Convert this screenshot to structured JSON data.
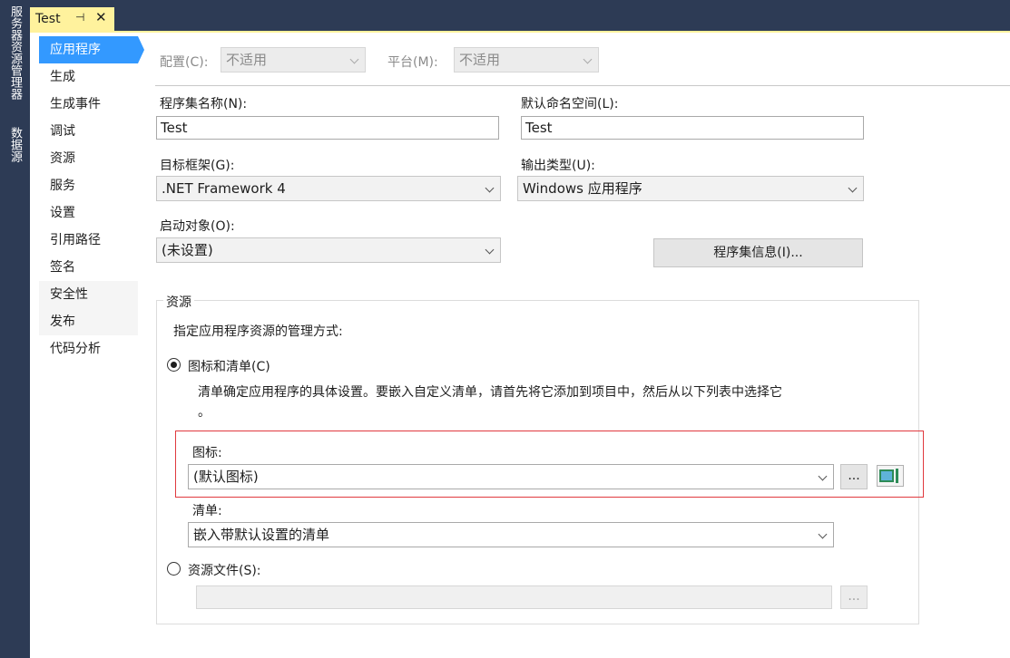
{
  "side_panels": [
    "服务器资源管理器",
    "数据源"
  ],
  "document_tab": {
    "title": "Test",
    "pin_icon": "pin-icon",
    "close_icon": "close-icon"
  },
  "nav": {
    "items": [
      "应用程序",
      "生成",
      "生成事件",
      "调试",
      "资源",
      "服务",
      "设置",
      "引用路径",
      "签名",
      "安全性",
      "发布",
      "代码分析"
    ],
    "active": "应用程序"
  },
  "config": {
    "config_label": "配置(C):",
    "config_value": "不适用",
    "platform_label": "平台(M):",
    "platform_value": "不适用"
  },
  "fields": {
    "assembly_name_label": "程序集名称(N):",
    "assembly_name_value": "Test",
    "default_namespace_label": "默认命名空间(L):",
    "default_namespace_value": "Test",
    "target_framework_label": "目标框架(G):",
    "target_framework_value": ".NET Framework 4",
    "output_type_label": "输出类型(U):",
    "output_type_value": "Windows 应用程序",
    "startup_object_label": "启动对象(O):",
    "startup_object_value": "(未设置)",
    "assembly_info_button": "程序集信息(I)..."
  },
  "resources": {
    "group_title": "资源",
    "description": "指定应用程序资源的管理方式:",
    "option_icon_manifest": "图标和清单(C)",
    "option_icon_manifest_desc_line1": "清单确定应用程序的具体设置。要嵌入自定义清单，请首先将它添加到项目中，然后从以下列表中选择它",
    "option_icon_manifest_desc_line2": "。",
    "icon_label": "图标:",
    "icon_value": "(默认图标)",
    "browse_button": "...",
    "manifest_label": "清单:",
    "manifest_value": "嵌入带默认设置的清单",
    "option_resource_file": "资源文件(S):",
    "resource_file_value": "",
    "resource_browse_button": "..."
  },
  "colors": {
    "chrome": "#2d3b55",
    "tab_yellow": "#fff29d",
    "accent": "#3399ff",
    "highlight_red": "#e0393e"
  }
}
